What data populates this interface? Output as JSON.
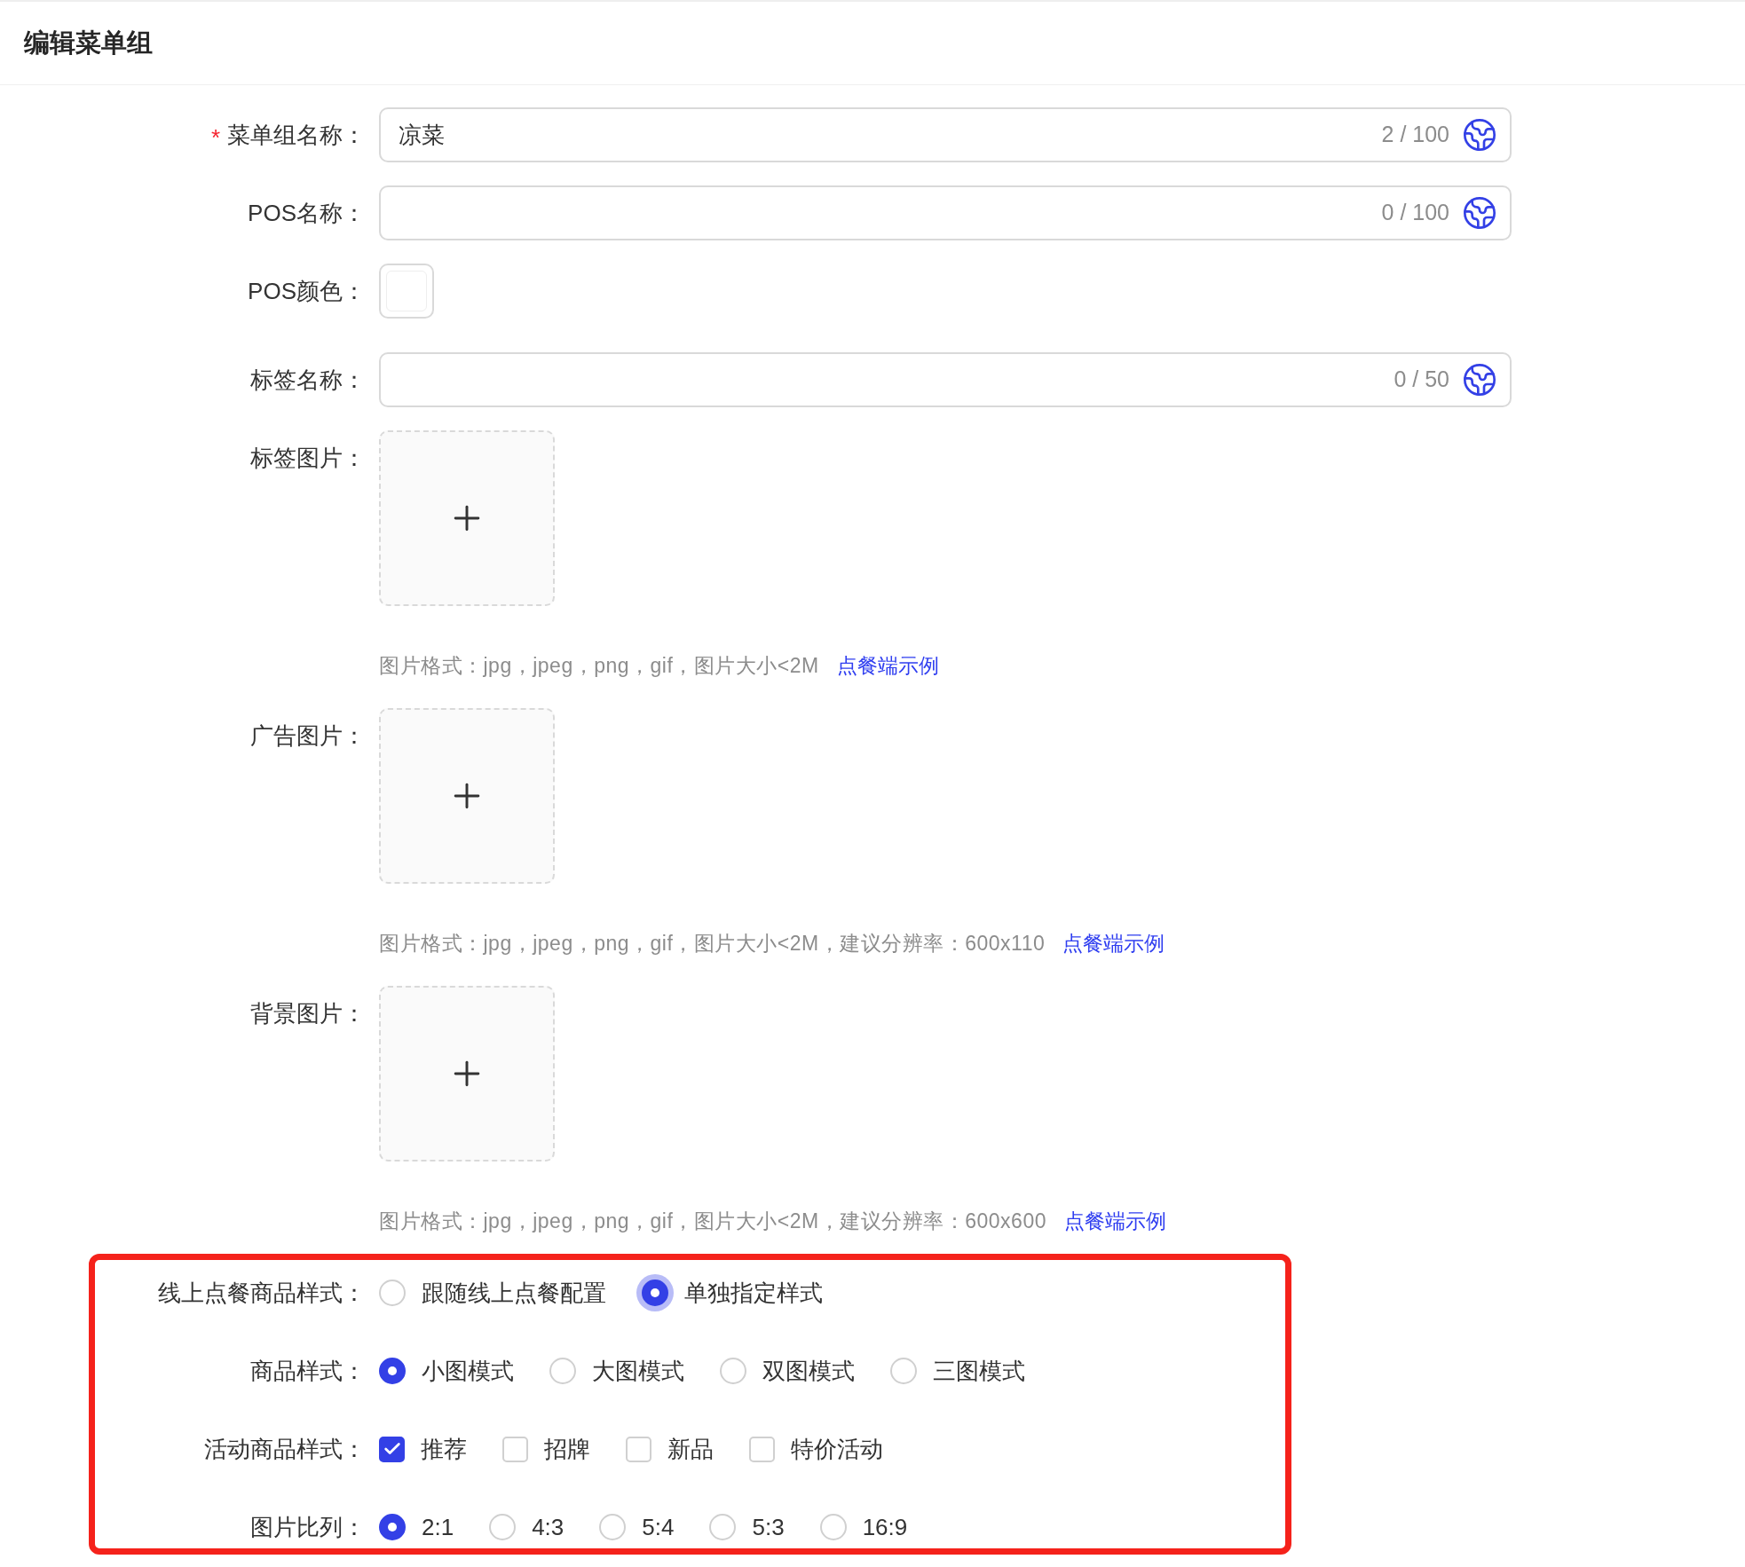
{
  "header": {
    "title": "编辑菜单组"
  },
  "fields": [
    {
      "kind": "text",
      "label": "菜单组名称：",
      "required_mark": "*",
      "value": "凉菜",
      "counter": "2 / 100"
    },
    {
      "kind": "text",
      "label": "POS名称：",
      "counter": "0 / 100"
    },
    {
      "kind": "color",
      "label": "POS颜色："
    },
    {
      "kind": "text",
      "label": "标签名称：",
      "counter": "0 / 50"
    },
    {
      "kind": "upload",
      "label": "标签图片：",
      "hint": "图片格式：jpg，jpeg，png，gif，图片大小<2M",
      "link": "点餐端示例"
    },
    {
      "kind": "upload",
      "label": "广告图片：",
      "hint": "图片格式：jpg，jpeg，png，gif，图片大小<2M，建议分辨率：600x110",
      "link": "点餐端示例"
    },
    {
      "kind": "upload",
      "label": "背景图片：",
      "hint": "图片格式：jpg，jpeg，png，gif，图片大小<2M，建议分辨率：600x600",
      "link": "点餐端示例"
    }
  ],
  "highlighted_section": {
    "fields": [
      {
        "kind": "radio",
        "label": "线上点餐商品样式：",
        "options": [
          {
            "label": "跟随线上点餐配置",
            "selected": false,
            "focused": false
          },
          {
            "label": "单独指定样式",
            "selected": true,
            "focused": true
          }
        ]
      },
      {
        "kind": "radio",
        "label": "商品样式：",
        "options": [
          {
            "label": "小图模式",
            "selected": true,
            "focused": false
          },
          {
            "label": "大图模式",
            "selected": false,
            "focused": false
          },
          {
            "label": "双图模式",
            "selected": false,
            "focused": false
          },
          {
            "label": "三图模式",
            "selected": false,
            "focused": false
          }
        ]
      },
      {
        "kind": "checkbox",
        "label": "活动商品样式：",
        "options": [
          {
            "label": "推荐",
            "checked": true
          },
          {
            "label": "招牌",
            "checked": false
          },
          {
            "label": "新品",
            "checked": false
          },
          {
            "label": "特价活动",
            "checked": false
          }
        ]
      },
      {
        "kind": "radio",
        "label": "图片比列：",
        "options": [
          {
            "label": "2:1",
            "selected": true,
            "focused": false
          },
          {
            "label": "4:3",
            "selected": false,
            "focused": false
          },
          {
            "label": "5:4",
            "selected": false,
            "focused": false
          },
          {
            "label": "5:3",
            "selected": false,
            "focused": false
          },
          {
            "label": "16:9",
            "selected": false,
            "focused": false
          }
        ]
      }
    ]
  }
}
